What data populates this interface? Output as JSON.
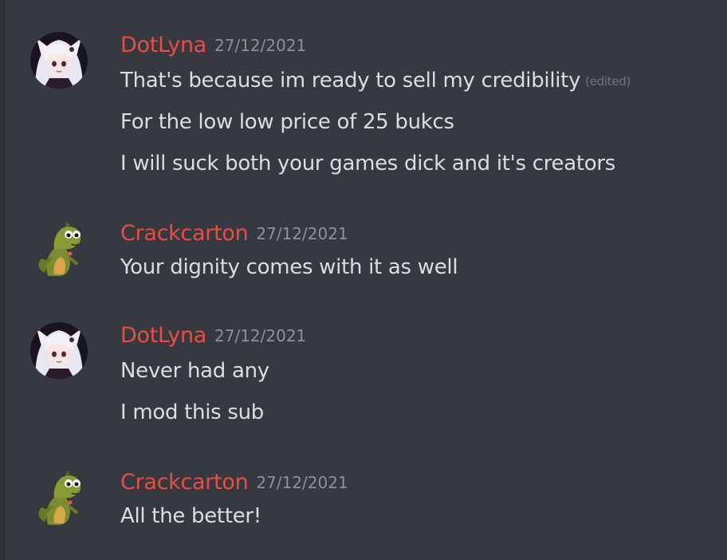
{
  "colors": {
    "background": "#36393f",
    "username": "#e94d45",
    "message_text": "#dcddde",
    "timestamp": "#8e9297",
    "edited": "#72767d"
  },
  "messages": [
    {
      "author": "DotLyna",
      "avatar_icon": "anime-girl-avatar-icon",
      "timestamp": "27/12/2021",
      "lines": [
        "That's because im ready to sell my credibility",
        "For the low low price of 25 bukcs",
        "I will suck both your games dick and it's creators"
      ],
      "edited_label": "(edited)"
    },
    {
      "author": "Crackcarton",
      "avatar_icon": "green-dinosaur-avatar-icon",
      "timestamp": "27/12/2021",
      "lines": [
        "Your dignity comes with it as well"
      ]
    },
    {
      "author": "DotLyna",
      "avatar_icon": "anime-girl-avatar-icon",
      "timestamp": "27/12/2021",
      "lines": [
        "Never had any",
        "I mod this sub"
      ]
    },
    {
      "author": "Crackcarton",
      "avatar_icon": "green-dinosaur-avatar-icon",
      "timestamp": "27/12/2021",
      "lines": [
        "All the better!"
      ]
    }
  ]
}
